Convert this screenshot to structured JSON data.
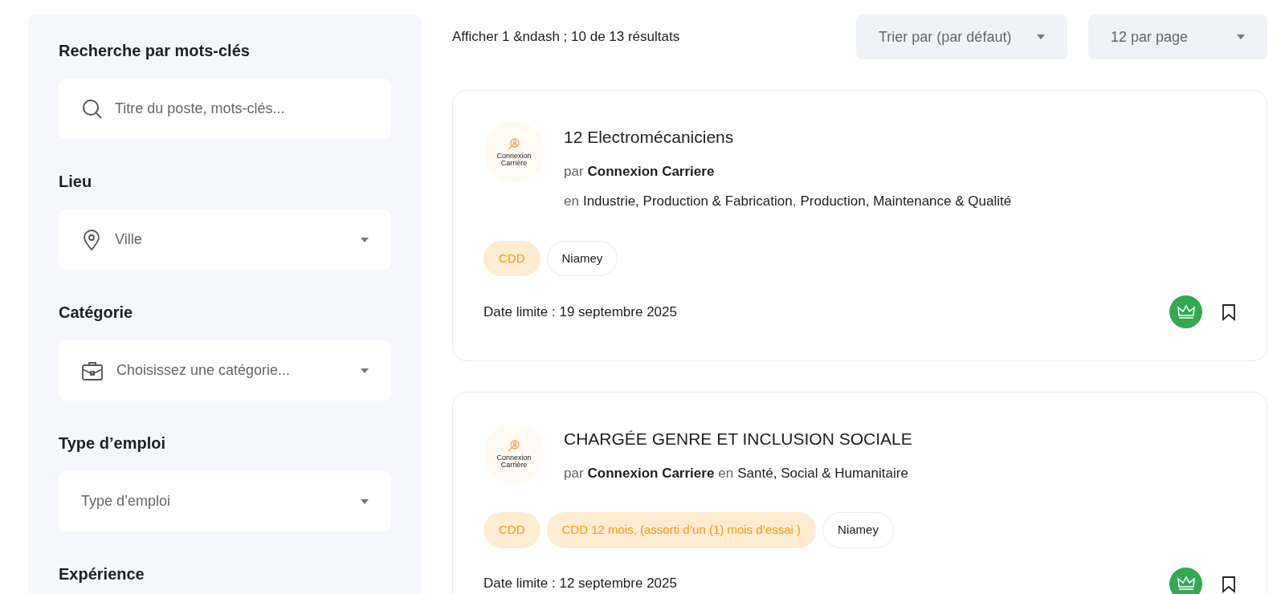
{
  "sidebar": {
    "sections": [
      {
        "label": "Recherche par mots-clés",
        "field": {
          "kind": "search",
          "placeholder": "Titre du poste, mots-clés..."
        }
      },
      {
        "label": "Lieu",
        "field": {
          "kind": "select",
          "value": "Ville"
        }
      },
      {
        "label": "Catégorie",
        "field": {
          "kind": "select",
          "value": "Choisissez une catégorie..."
        }
      },
      {
        "label": "Type d’emploi",
        "field": {
          "kind": "select",
          "value": "Type d’emploi"
        }
      },
      {
        "label": "Expérience"
      }
    ]
  },
  "results": {
    "count_text": "Afficher 1 &ndash ; 10 de 13 résultats",
    "sort": {
      "value": "Trier par (par défaut)"
    },
    "per_page": {
      "value": "12 par page"
    }
  },
  "jobs": [
    {
      "logo": [
        "Connexion",
        "Carrière"
      ],
      "title": "12 Electromécaniciens",
      "lines": [
        [
          {
            "kind": "label",
            "text": "par"
          },
          {
            "kind": "company",
            "text": "Connexion Carriere"
          }
        ],
        [
          {
            "kind": "label",
            "text": "en"
          },
          {
            "kind": "category",
            "text": "Industrie, Production & Fabrication"
          },
          {
            "kind": "separator",
            "text": ","
          },
          {
            "kind": "category",
            "text": "Production, Maintenance & Qualité"
          }
        ]
      ],
      "tags": [
        {
          "kind": "type",
          "text": "CDD"
        },
        {
          "kind": "location",
          "text": "Niamey"
        }
      ],
      "deadline": "Date limite : 19 septembre 2025",
      "featured": true,
      "bookmarked": false
    },
    {
      "logo": [
        "Connexion",
        "Carrière"
      ],
      "title": "CHARGÉE GENRE ET INCLUSION SOCIALE",
      "lines": [
        [
          {
            "kind": "label",
            "text": "par"
          },
          {
            "kind": "company",
            "text": "Connexion Carriere"
          },
          {
            "kind": "label",
            "text": "en"
          },
          {
            "kind": "category",
            "text": "Santé, Social & Humanitaire"
          }
        ]
      ],
      "tags": [
        {
          "kind": "type",
          "text": "CDD"
        },
        {
          "kind": "type",
          "text": "CDD 12 mois, (assorti d’un (1) mois d’essai )"
        },
        {
          "kind": "location",
          "text": "Niamey"
        }
      ],
      "deadline": "Date limite : 12 septembre 2025",
      "featured": true,
      "bookmarked": false
    }
  ]
}
